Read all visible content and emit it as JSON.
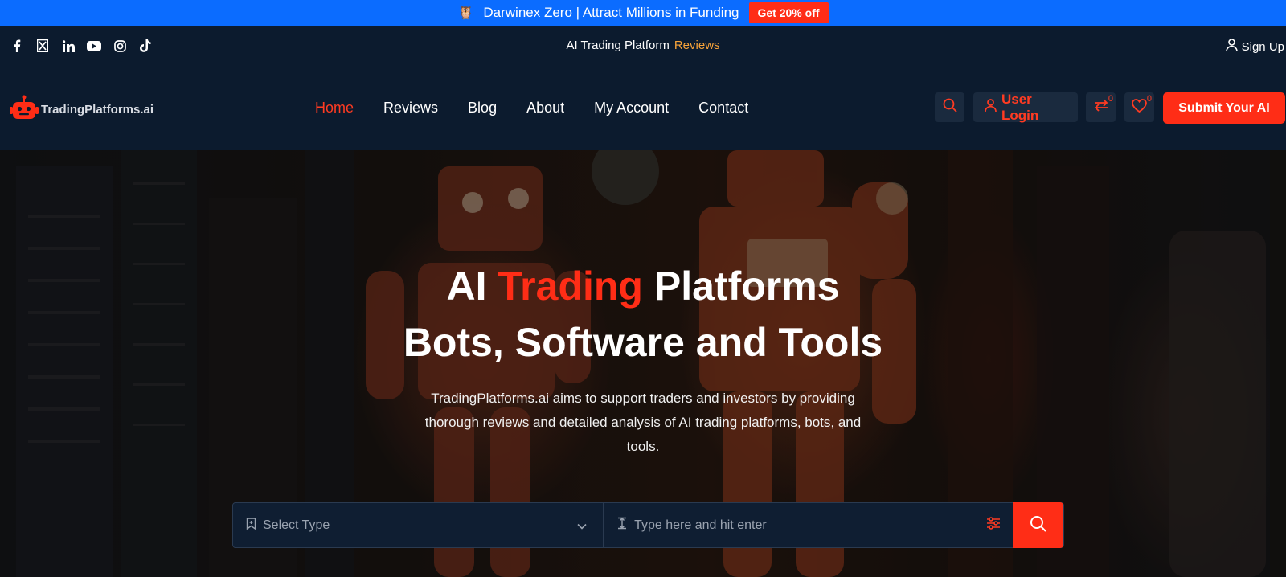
{
  "promo": {
    "text": "Darwinex Zero | Attract Millions in Funding",
    "button": "Get 20% off"
  },
  "topbar": {
    "socials": [
      "facebook-icon",
      "x-icon",
      "linkedin-icon",
      "youtube-icon",
      "instagram-icon",
      "tiktok-icon"
    ],
    "center_text": "AI Trading Platform",
    "center_link": "Reviews",
    "signup": "Sign Up"
  },
  "header": {
    "logo_text": "TradingPlatforms.ai",
    "nav": [
      {
        "label": "Home",
        "active": true
      },
      {
        "label": "Reviews",
        "active": false
      },
      {
        "label": "Blog",
        "active": false
      },
      {
        "label": "About",
        "active": false
      },
      {
        "label": "My Account",
        "active": false
      },
      {
        "label": "Contact",
        "active": false
      }
    ],
    "login": "User Login",
    "compare_count": "0",
    "wishlist_count": "0",
    "submit": "Submit Your AI"
  },
  "hero": {
    "title_part1": "AI",
    "title_accent": "Trading",
    "title_part2": "Platforms",
    "title_line2": "Bots, Software and Tools",
    "description": "TradingPlatforms.ai aims to support traders and investors by providing thorough reviews and detailed analysis of AI trading platforms, bots, and tools."
  },
  "search": {
    "type_placeholder": "Select Type",
    "query_placeholder": "Type here and hit enter"
  },
  "colors": {
    "accent": "#ff2d16",
    "navy": "#0c1b2e",
    "promo_blue": "#0b6cff",
    "link_orange": "#f7a33a"
  }
}
